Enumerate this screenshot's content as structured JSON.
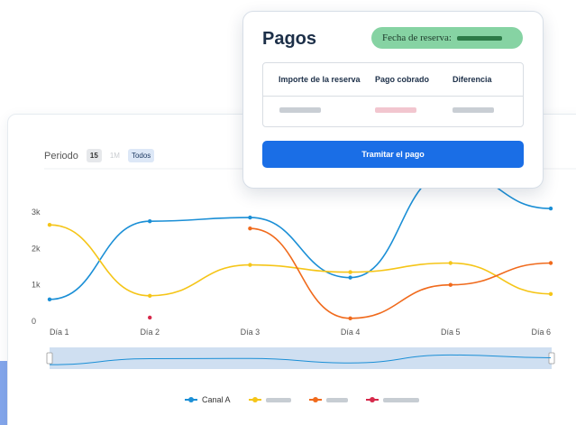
{
  "periodo": {
    "label": "Periodo",
    "buttons": [
      "15",
      "1M",
      "Todos"
    ]
  },
  "colors": {
    "canal_a": "#1b8fd6",
    "yellow": "#f5c518",
    "orange": "#f06a1c",
    "red": "#d6294b"
  },
  "chart_data": {
    "type": "line",
    "x": [
      "Día 1",
      "Día 2",
      "Día 3",
      "Día 4",
      "Día 5",
      "Día 6"
    ],
    "ylim": [
      0,
      3200
    ],
    "y_ticks": [
      "0",
      "1k",
      "2k",
      "3k"
    ],
    "series": [
      {
        "name": "Canal A",
        "values": [
          600,
          2750,
          2850,
          1200,
          4100,
          3100
        ]
      },
      {
        "name": "",
        "values": [
          2650,
          700,
          1550,
          1350,
          1600,
          750
        ]
      },
      {
        "name": "",
        "values": [
          null,
          null,
          2550,
          80,
          1000,
          1600
        ]
      },
      {
        "name": "",
        "values": [
          null,
          100,
          null,
          null,
          null,
          null
        ]
      }
    ]
  },
  "legend": {
    "canal_a": "Canal A"
  },
  "pagos": {
    "title": "Pagos",
    "badge_label": "Fecha de reserva:",
    "columns": [
      "Importe de la reserva",
      "Pago cobrado",
      "Diferencia"
    ],
    "button": "Tramitar el pago"
  }
}
